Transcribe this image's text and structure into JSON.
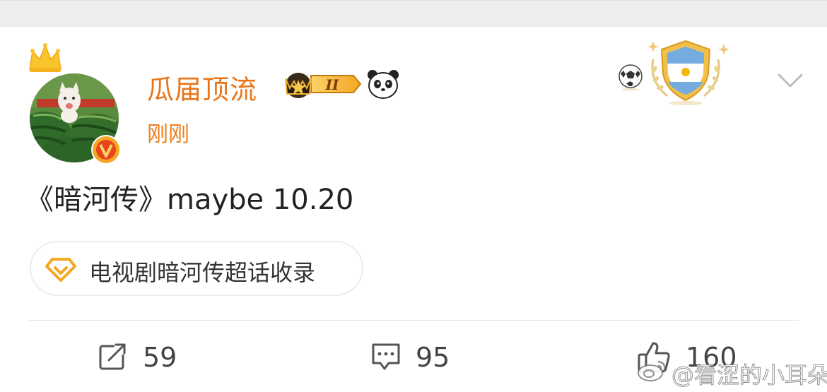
{
  "post": {
    "username": "瓜届顶流",
    "timestamp": "刚刚",
    "text": "《暗河传》maybe 10.20",
    "rank_badge_numeral": "II",
    "topic": {
      "label": "电视剧暗河传超话收录",
      "icon": "diamond-icon"
    }
  },
  "actions": {
    "repost_count": "59",
    "comment_count": "95",
    "like_count": "160"
  },
  "watermark": {
    "text": "@看涩的小耳朵"
  },
  "icons": {
    "crown": "crown-icon",
    "verified": "verified-badge-icon",
    "rank": "rank-crown-badge",
    "panda": "panda-icon",
    "soccer": "soccer-ball-icon",
    "argentina": "argentina-shield-badge",
    "chevron": "chevron-down-icon",
    "repost": "repost-icon",
    "comment": "comment-icon",
    "like": "thumbs-up-icon"
  },
  "colors": {
    "username": "#e8751a",
    "timestamp": "#f07e1d",
    "text": "#222222",
    "verified": "#f5a623",
    "topic_icon": "#f5a623",
    "divider": "#e6e6e6",
    "top_strip": "#eeeeee"
  }
}
